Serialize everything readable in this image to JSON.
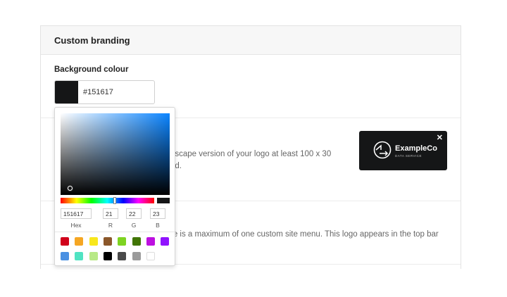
{
  "panel": {
    "title": "Custom branding"
  },
  "background": {
    "label": "Background colour",
    "value": "#151617",
    "swatch_color": "#151617"
  },
  "logo_section": {
    "description_line1": "dscape version of your logo at least 100 x 30",
    "description_line2": "nd.",
    "preview": {
      "name": "ExampleCo",
      "tagline": "DATA SERVICE",
      "close_glyph": "✕"
    }
  },
  "menu_section": {
    "description_line1": "re is a maximum of one custom site menu. This logo appears in the top bar",
    "description_line2": "."
  },
  "picker": {
    "hex_value": "151617",
    "r_value": "21",
    "g_value": "22",
    "b_value": "23",
    "hex_label": "Hex",
    "r_label": "R",
    "g_label": "G",
    "b_label": "B",
    "hue_color": "#0a84ff",
    "presets": [
      "#d0021b",
      "#f5a623",
      "#f8e71c",
      "#8b572a",
      "#7ed321",
      "#417505",
      "#bd10e0",
      "#9013fe",
      "#4a90e2",
      "#50e3c2",
      "#b8e986",
      "#000000",
      "#4a4a4a",
      "#9b9b9b",
      "#ffffff"
    ]
  }
}
